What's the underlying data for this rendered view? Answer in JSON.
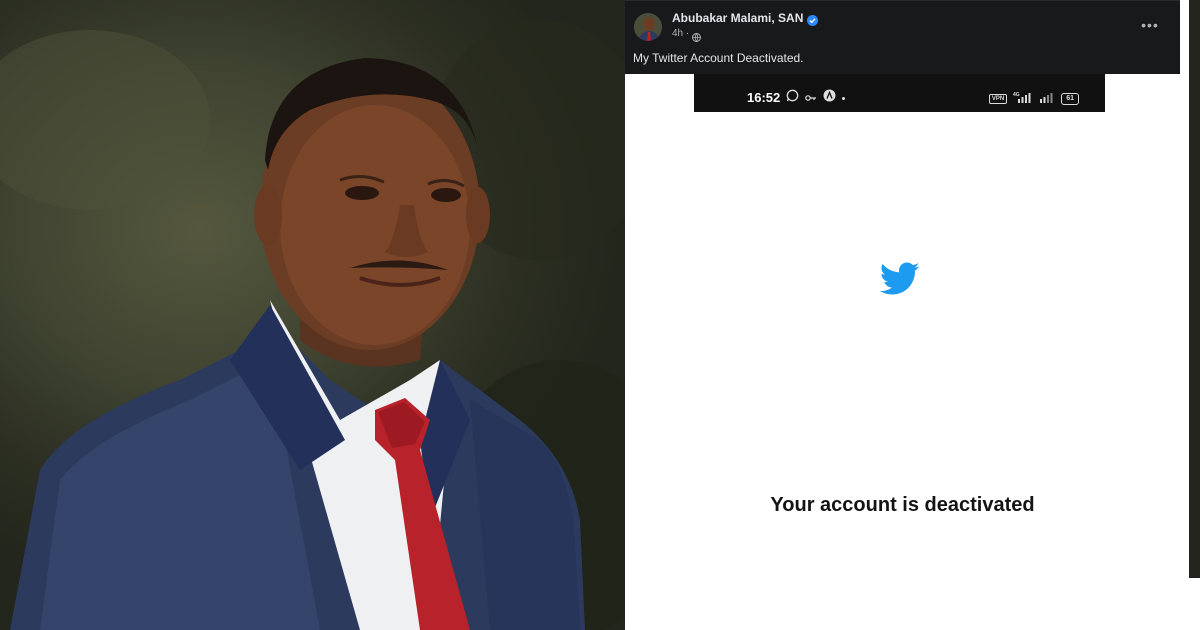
{
  "post": {
    "author": "Abubakar Malami, SAN",
    "time": "4h ·",
    "text": "My Twitter Account Deactivated.",
    "more_label": "•••"
  },
  "screenshot": {
    "status_time": "16:52",
    "vpn_label": "VPN",
    "network_label": "4G",
    "battery": "61",
    "message": "Your account is deactivated"
  },
  "colors": {
    "header_bg": "#18191a",
    "twitter_blue": "#1d9bf0",
    "verified_blue": "#2d88ff"
  },
  "icons": {
    "verified": "verified-badge-icon",
    "globe": "globe-icon",
    "more": "more-options-icon",
    "twitter": "twitter-bird-icon"
  }
}
